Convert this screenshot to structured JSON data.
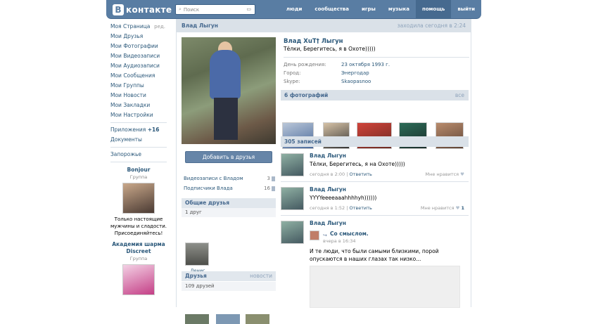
{
  "header": {
    "logo_letter": "В",
    "logo_text": "контакте",
    "search_placeholder": "Поиск",
    "search_icon": "magnifier-icon",
    "nav": [
      "люди",
      "сообщества",
      "игры",
      "музыка",
      "помощь",
      "выйти"
    ]
  },
  "sidebar": {
    "items": [
      "Моя Страница",
      "Мои Друзья",
      "Мои Фотографии",
      "Мои Видеозаписи",
      "Мои Аудиозаписи",
      "Мои Сообщения",
      "Мои Группы",
      "Мои Новости",
      "Мои Закладки",
      "Мои Настройки"
    ],
    "edit": "ред.",
    "apps": "Приложения",
    "apps_count": "+16",
    "docs": "Документы",
    "zaporozhe": "Запорожье",
    "ad1": {
      "title": "Bonjour",
      "sub": "Группа",
      "text": "Только настоящие мужчины и сладости. Присоединяйтесь!"
    },
    "ad2": {
      "title": "Академия шарма Discreet",
      "sub": "Группа"
    }
  },
  "profile": {
    "header_name": "Влад Лыгун",
    "last_seen": "заходила сегодня в 2:24",
    "name": "Влад ХuТ† Лыгун",
    "status": "Тёлки, Берегитесь, я в Охоте)))))",
    "fields": [
      {
        "k": "День рождения:",
        "v": "23 октября 1993 г."
      },
      {
        "k": "Город:",
        "v": "Энергодар"
      },
      {
        "k": "Skype:",
        "v": "Skaopasnoo"
      }
    ],
    "add_friend": "Добавить в друзья",
    "videos": "Видеозаписи с Владом",
    "videos_count": "3",
    "subs": "Подписчики Влада",
    "subs_count": "16",
    "common_friends_title": "Общие друзья",
    "common_friends_count": "1 друг",
    "common_friend_name": "Денис Козяцкий",
    "friends_title": "Друзья",
    "friends_right": "новости",
    "friends_count": "109 друзей",
    "photos_title": "6 фотографий",
    "photos_all": "все",
    "posts_title": "305 записей"
  },
  "posts": [
    {
      "name": "Влад Лыгун",
      "text": "Тёлки, Берегитесь, я на Охоте)))))",
      "time": "сегодня в 2:00",
      "reply": "Ответить",
      "like": "Мне нравится",
      "like_count": ""
    },
    {
      "name": "Влад Лыгун",
      "text": "YYYYeeeeaaahhhhyh))))))",
      "time": "сегодня в 1:52",
      "reply": "Ответить",
      "like": "Мне нравится",
      "like_count": "1"
    },
    {
      "name": "Влад Лыгун",
      "repost_group": "Со смыслом.",
      "repost_time": "вчера в 16:34",
      "text": "И те люди, что были самыми близкими, порой опускаются в наших глазах так низко..."
    }
  ]
}
